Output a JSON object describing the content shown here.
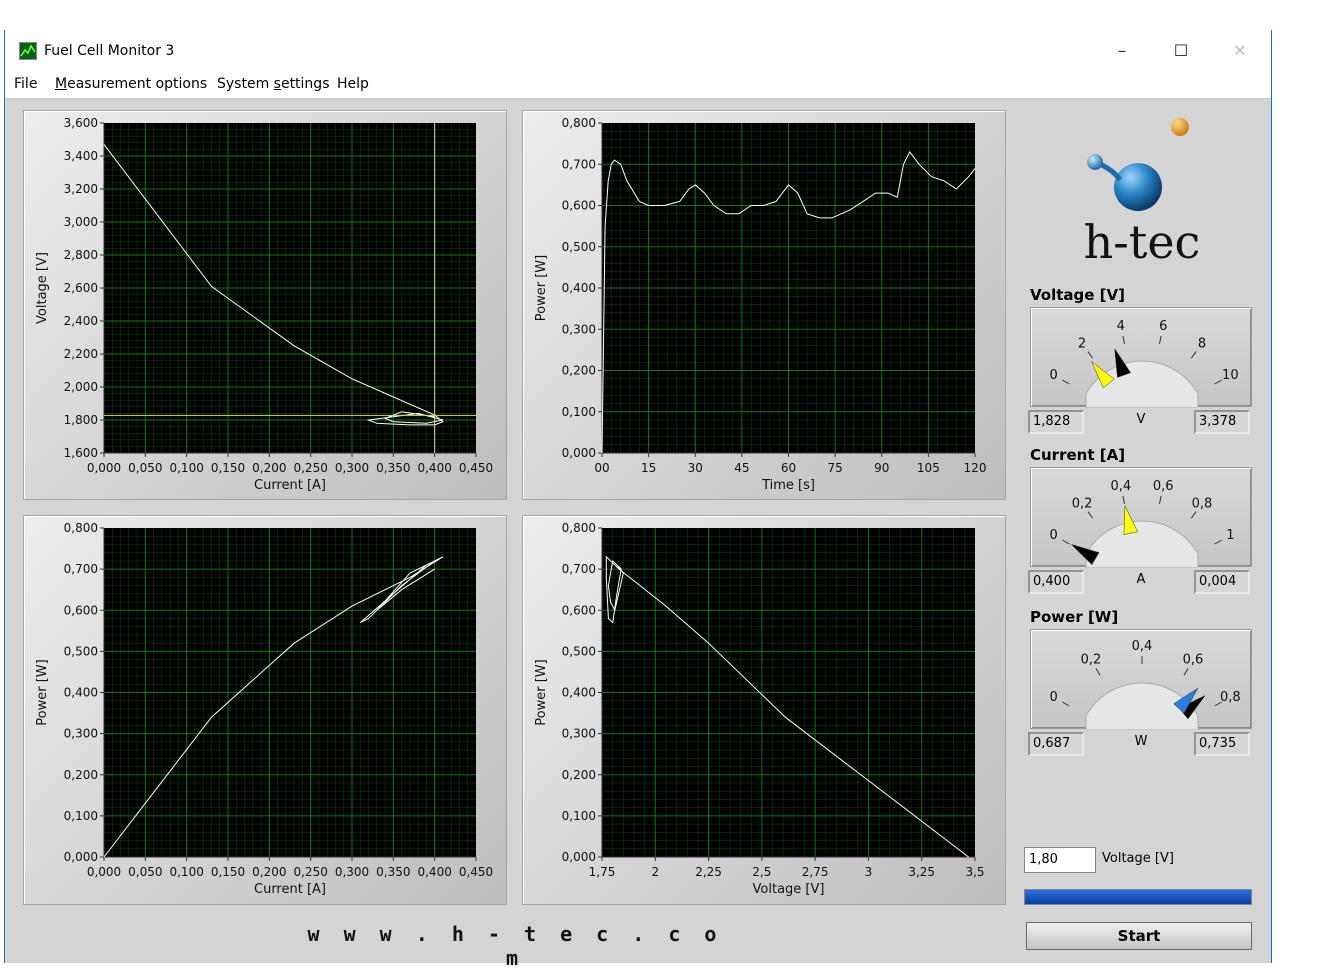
{
  "window": {
    "title": "Fuel Cell Monitor 3",
    "controls": {
      "minimize": "–",
      "maximize": "☐",
      "close": "✕"
    }
  },
  "menu": [
    {
      "pre": "File",
      "ul": "",
      "post": ""
    },
    {
      "pre": "",
      "ul": "M",
      "post": "easurement options"
    },
    {
      "pre": "System ",
      "ul": "s",
      "post": "ettings"
    },
    {
      "pre": "Help",
      "ul": "",
      "post": ""
    }
  ],
  "chart_data": [
    {
      "type": "line",
      "xlabel": "Current [A]",
      "ylabel": "Voltage [V]",
      "xlim": [
        0,
        0.45
      ],
      "ylim": [
        1.6,
        3.6
      ],
      "xticks": [
        "0,000",
        "0,050",
        "0,100",
        "0,150",
        "0,200",
        "0,250",
        "0,300",
        "0,350",
        "0,400",
        "0,450"
      ],
      "yticks": [
        "1,600",
        "1,800",
        "2,000",
        "2,200",
        "2,400",
        "2,600",
        "2,800",
        "3,000",
        "3,200",
        "3,400",
        "3,600"
      ],
      "cursor": {
        "x": 0.4,
        "y": 1.828
      },
      "series": [
        {
          "x": [
            0,
            0.13,
            0.23,
            0.3,
            0.4,
            0.41,
            0.4,
            0.37,
            0.33,
            0.32,
            0.35,
            0.38,
            0.41,
            0.39,
            0.35,
            0.34,
            0.36,
            0.4
          ],
          "y": [
            3.47,
            2.61,
            2.25,
            2.05,
            1.83,
            1.79,
            1.77,
            1.77,
            1.78,
            1.8,
            1.82,
            1.84,
            1.8,
            1.78,
            1.79,
            1.81,
            1.85,
            1.82
          ]
        }
      ]
    },
    {
      "type": "line",
      "xlabel": "Time [s]",
      "ylabel": "Power [W]",
      "xlim": [
        0,
        120
      ],
      "ylim": [
        0,
        0.8
      ],
      "xticks": [
        "00",
        "15",
        "30",
        "45",
        "60",
        "75",
        "90",
        "105",
        "120"
      ],
      "yticks": [
        "0,000",
        "0,100",
        "0,200",
        "0,300",
        "0,400",
        "0,500",
        "0,600",
        "0,700",
        "0,800"
      ],
      "series": [
        {
          "x": [
            0,
            1,
            2,
            3,
            4,
            6,
            8,
            12,
            15,
            20,
            25,
            28,
            30,
            33,
            36,
            40,
            44,
            48,
            52,
            56,
            60,
            63,
            66,
            70,
            74,
            77,
            80,
            84,
            88,
            92,
            95,
            97,
            99,
            102,
            106,
            110,
            114,
            118,
            120
          ],
          "y": [
            0.0,
            0.55,
            0.66,
            0.7,
            0.71,
            0.7,
            0.66,
            0.61,
            0.6,
            0.6,
            0.61,
            0.64,
            0.65,
            0.63,
            0.6,
            0.58,
            0.58,
            0.6,
            0.6,
            0.61,
            0.65,
            0.63,
            0.58,
            0.57,
            0.57,
            0.58,
            0.59,
            0.61,
            0.63,
            0.63,
            0.62,
            0.7,
            0.73,
            0.7,
            0.67,
            0.66,
            0.64,
            0.67,
            0.69
          ]
        }
      ]
    },
    {
      "type": "line",
      "xlabel": "Current [A]",
      "ylabel": "Power [W]",
      "xlim": [
        0,
        0.45
      ],
      "ylim": [
        0,
        0.8
      ],
      "xticks": [
        "0,000",
        "0,050",
        "0,100",
        "0,150",
        "0,200",
        "0,250",
        "0,300",
        "0,350",
        "0,400",
        "0,450"
      ],
      "yticks": [
        "0,000",
        "0,100",
        "0,200",
        "0,300",
        "0,400",
        "0,500",
        "0,600",
        "0,700",
        "0,800"
      ],
      "series": [
        {
          "x": [
            0,
            0.13,
            0.23,
            0.3,
            0.37,
            0.41,
            0.4,
            0.36,
            0.32,
            0.31,
            0.35,
            0.39,
            0.41,
            0.37,
            0.33,
            0.36,
            0.4
          ],
          "y": [
            0.0,
            0.34,
            0.52,
            0.61,
            0.68,
            0.73,
            0.72,
            0.66,
            0.58,
            0.57,
            0.64,
            0.71,
            0.73,
            0.69,
            0.6,
            0.65,
            0.7
          ]
        }
      ]
    },
    {
      "type": "line",
      "xlabel": "Voltage [V]",
      "ylabel": "Power [W]",
      "xlim": [
        1.75,
        3.5
      ],
      "ylim": [
        0,
        0.8
      ],
      "xticks": [
        "1,75",
        "2",
        "2,25",
        "2,5",
        "2,75",
        "3",
        "3,25",
        "3,5"
      ],
      "yticks": [
        "0,000",
        "0,100",
        "0,200",
        "0,300",
        "0,400",
        "0,500",
        "0,600",
        "0,700",
        "0,800"
      ],
      "series": [
        {
          "x": [
            3.47,
            2.61,
            2.25,
            2.05,
            1.83,
            1.79,
            1.77,
            1.77,
            1.78,
            1.8,
            1.82,
            1.84,
            1.8,
            1.78,
            1.79,
            1.81,
            1.85,
            1.82
          ],
          "y": [
            0.0,
            0.34,
            0.52,
            0.61,
            0.7,
            0.72,
            0.73,
            0.68,
            0.58,
            0.57,
            0.64,
            0.7,
            0.72,
            0.66,
            0.62,
            0.6,
            0.69,
            0.71
          ]
        }
      ]
    }
  ],
  "brand": {
    "logo_text": "h-tec",
    "website": "w w w . h - t e c . c o m"
  },
  "meters": [
    {
      "title": "Voltage [V]",
      "unit": "V",
      "ticks": [
        "0",
        "2",
        "4",
        "6",
        "8",
        "10"
      ],
      "max": 10,
      "value": 1.828,
      "peak": 3.378,
      "value_text": "1,828",
      "peak_text": "3,378",
      "needle_color": "#ffff00",
      "peak_color": "#000000"
    },
    {
      "title": "Current [A]",
      "unit": "A",
      "ticks": [
        "0",
        "0,2",
        "0,4",
        "0,6",
        "0,8",
        "1"
      ],
      "max": 1,
      "value": 0.4,
      "peak": 0.004,
      "value_text": "0,400",
      "peak_text": "0,004",
      "needle_color": "#ffff00",
      "peak_color": "#000000"
    },
    {
      "title": "Power [W]",
      "unit": "W",
      "ticks": [
        "0",
        "0,2",
        "0,4",
        "0,6",
        "0,8"
      ],
      "max": 0.8,
      "value": 0.687,
      "peak": 0.735,
      "value_text": "0,687",
      "peak_text": "0,735",
      "needle_color": "#2a7de1",
      "peak_color": "#000000"
    }
  ],
  "setpoint": {
    "value": "1,80",
    "label": "Voltage [V]"
  },
  "progress": {
    "fraction": 1.0
  },
  "start_button": {
    "label": "Start"
  },
  "colors": {
    "plot_bg": "#000000",
    "grid": "#0a8a0a",
    "trace": "#ffffff",
    "cursor": "#d8d27a",
    "accent": "#1f6fb4"
  }
}
